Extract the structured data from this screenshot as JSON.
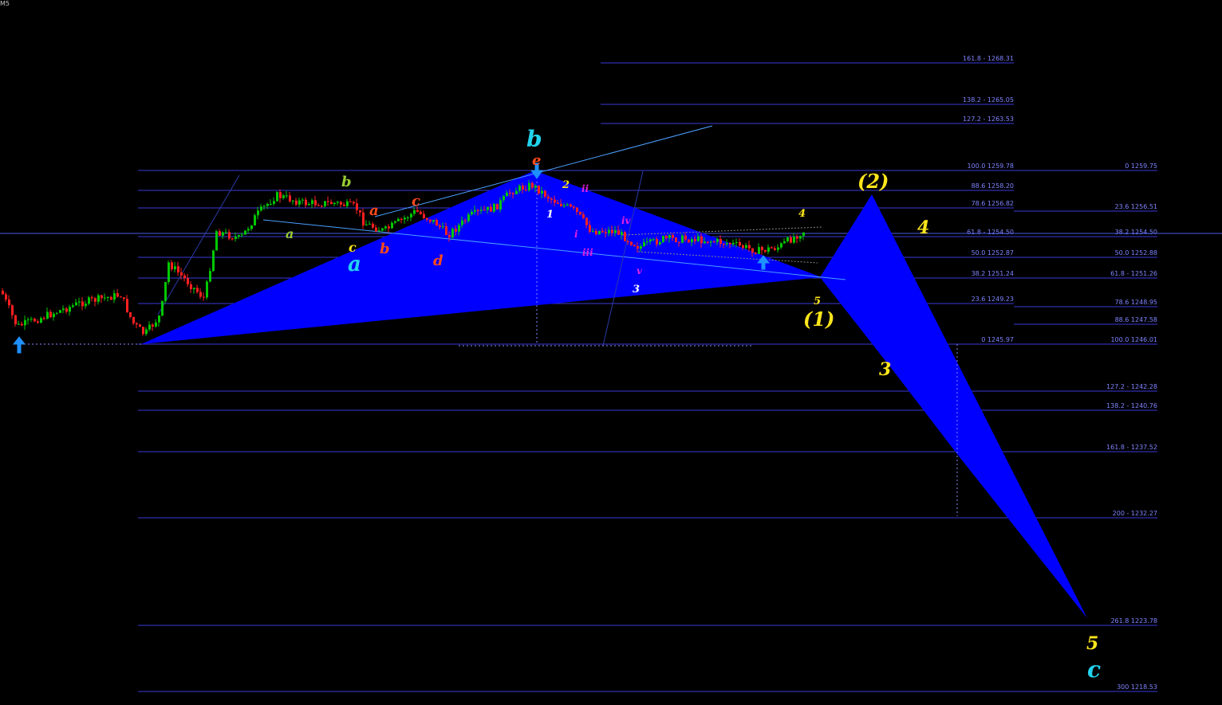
{
  "window": {
    "timeframe_label": "M5"
  },
  "colors": {
    "background": "#000000",
    "fib_line": "#3a3ad8",
    "fib_text": "#7f84ff",
    "pattern_fill": "#0000ff",
    "bull_candle": "#00c800",
    "bear_candle": "#ff2020",
    "cyan_label": "#22d3ee",
    "yellow_label": "#ffe61a",
    "orange_label": "#ff4a1a",
    "magenta_label": "#e020e0",
    "olive_label": "#9acd32",
    "white_label": "#ffffff"
  },
  "chart_data": {
    "type": "candlestick",
    "symbol_timeframe": "M5",
    "price_levels_left_fib": [
      {
        "ratio": "161.8",
        "price": 1268.31,
        "label": "161.8 - 1268.31"
      },
      {
        "ratio": "138.2",
        "price": 1265.05,
        "label": "138.2 - 1265.05"
      },
      {
        "ratio": "127.2",
        "price": 1263.53,
        "label": "127.2 - 1263.53"
      },
      {
        "ratio": "100.0",
        "price": 1259.78,
        "label": "100.0 1259.78"
      },
      {
        "ratio": "88.6",
        "price": 1258.2,
        "label": "88.6 1258.20"
      },
      {
        "ratio": "78.6",
        "price": 1256.82,
        "label": "78.6 1256.82"
      },
      {
        "ratio": "61.8",
        "price": 1254.5,
        "label": "61.8 - 1254.50"
      },
      {
        "ratio": "50.0",
        "price": 1252.87,
        "label": "50.0 1252.87"
      },
      {
        "ratio": "38.2",
        "price": 1251.24,
        "label": "38.2 1251.24"
      },
      {
        "ratio": "23.6",
        "price": 1249.23,
        "label": "23.6 1249.23"
      },
      {
        "ratio": "0",
        "price": 1245.97,
        "label": "0 1245.97"
      }
    ],
    "price_levels_right_fib": [
      {
        "ratio": "0",
        "price": 1259.75,
        "label": "0 1259.75"
      },
      {
        "ratio": "23.6",
        "price": 1256.51,
        "label": "23.6 1256.51"
      },
      {
        "ratio": "38.2",
        "price": 1254.5,
        "label": "38.2 1254.50"
      },
      {
        "ratio": "50.0",
        "price": 1252.88,
        "label": "50.0 1252.88"
      },
      {
        "ratio": "61.8",
        "price": 1251.26,
        "label": "61.8 - 1251.26"
      },
      {
        "ratio": "78.6",
        "price": 1248.95,
        "label": "78.6 1248.95"
      },
      {
        "ratio": "88.6",
        "price": 1247.58,
        "label": "88.6 1247.58"
      },
      {
        "ratio": "100.0",
        "price": 1246.01,
        "label": "100.0 1246.01"
      },
      {
        "ratio": "127.2",
        "price": 1242.28,
        "label": "127.2 - 1242.28"
      },
      {
        "ratio": "138.2",
        "price": 1240.76,
        "label": "138.2 - 1240.76"
      },
      {
        "ratio": "161.8",
        "price": 1237.52,
        "label": "161.8 - 1237.52"
      },
      {
        "ratio": "200",
        "price": 1232.27,
        "label": "200 - 1232.27"
      },
      {
        "ratio": "261.8",
        "price": 1223.78,
        "label": "261.8 1223.78"
      },
      {
        "ratio": "300",
        "price": 1218.53,
        "label": "300 1218.53"
      }
    ],
    "current_price": 1254.5,
    "wave_labels": {
      "major": [
        "a",
        "b",
        "c"
      ],
      "minor": [
        "a",
        "b",
        "c",
        "d",
        "e"
      ],
      "sub": [
        "a",
        "b",
        "c"
      ],
      "impulse_numbers": [
        "1",
        "2",
        "3",
        "4",
        "5"
      ],
      "roman": [
        "i",
        "ii",
        "iii",
        "iv",
        "v"
      ],
      "projection": [
        "(1)",
        "(2)",
        "3",
        "4",
        "5"
      ]
    }
  }
}
